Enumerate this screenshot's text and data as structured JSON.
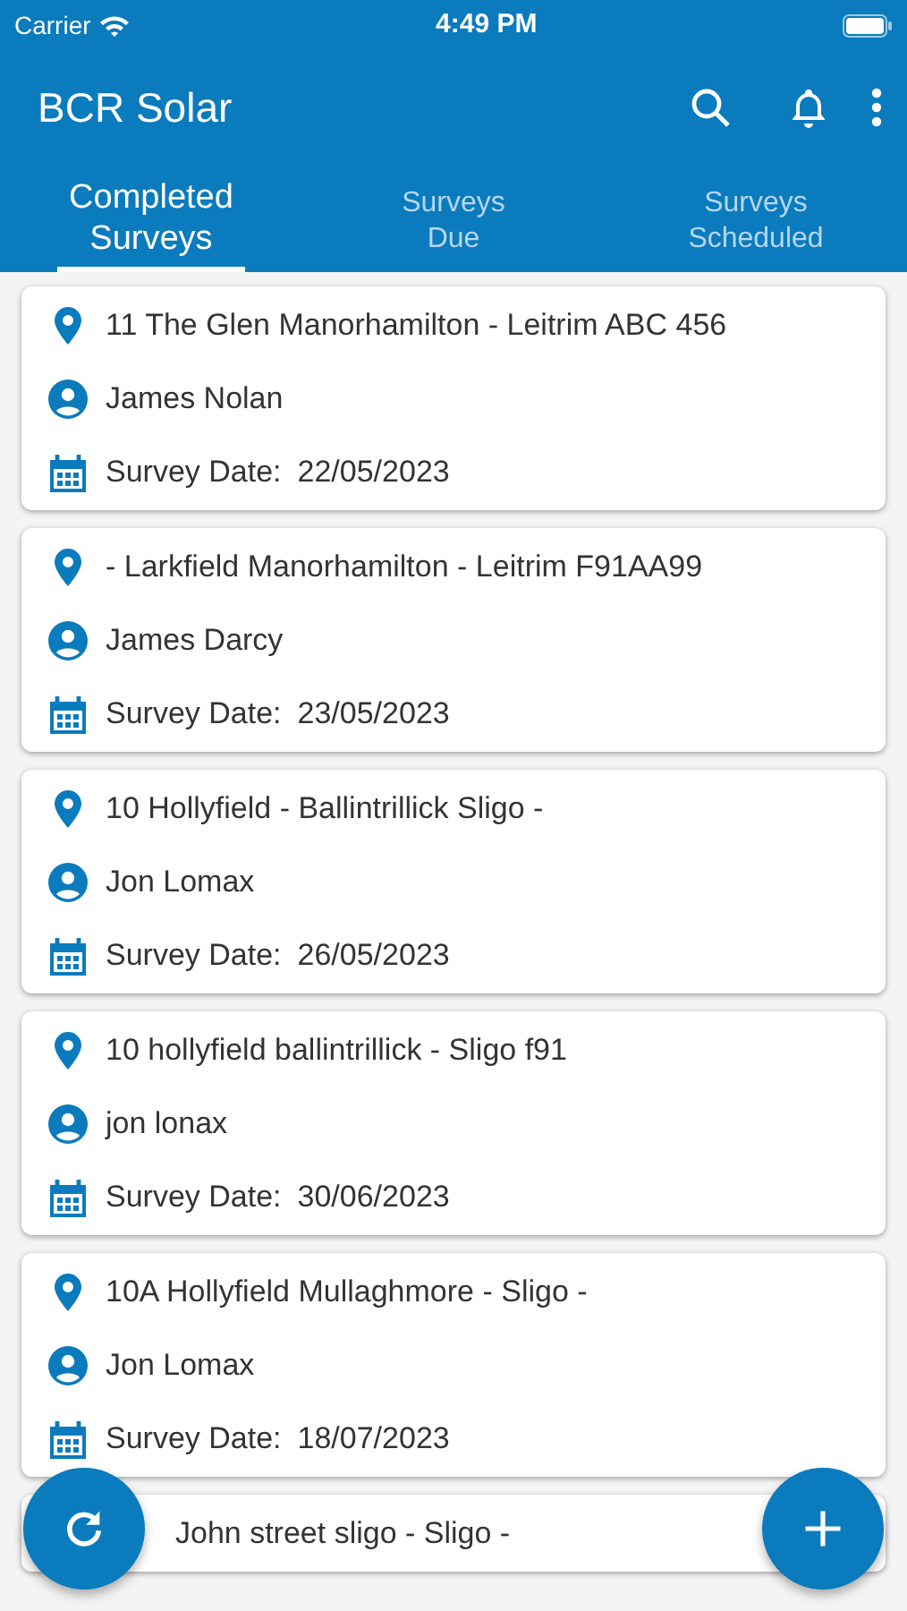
{
  "status_bar": {
    "carrier": "Carrier",
    "time": "4:49 PM"
  },
  "app_bar": {
    "title": "BCR Solar"
  },
  "tabs": [
    {
      "label": "Completed Surveys",
      "selected": true
    },
    {
      "label": "Surveys Due",
      "selected": false
    },
    {
      "label": "Surveys Scheduled",
      "selected": false
    }
  ],
  "surveys": [
    {
      "address": "11 The Glen Manorhamilton - Leitrim ABC 456",
      "clipped": false,
      "name": "James Nolan",
      "date_label": "Survey Date:",
      "date": "22/05/2023"
    },
    {
      "address": "- Larkfield Manorhamilton - Leitrim F91AA99",
      "clipped": false,
      "name": "James Darcy",
      "date_label": "Survey Date:",
      "date": "23/05/2023"
    },
    {
      "address": "10 Hollyfield - Ballintrillick Sligo -",
      "clipped": false,
      "name": "Jon Lomax",
      "date_label": "Survey Date:",
      "date": "26/05/2023"
    },
    {
      "address": "10 hollyfield ballintrillick - Sligo f91",
      "clipped": false,
      "name": "jon lonax",
      "date_label": "Survey Date:",
      "date": "30/06/2023"
    },
    {
      "address": "10A Hollyfield Mullaghmore - Sligo -",
      "clipped": false,
      "name": "Jon Lomax",
      "date_label": "Survey Date:",
      "date": "18/07/2023"
    },
    {
      "address": "John street sligo - Sligo -",
      "clipped": true
    }
  ]
}
